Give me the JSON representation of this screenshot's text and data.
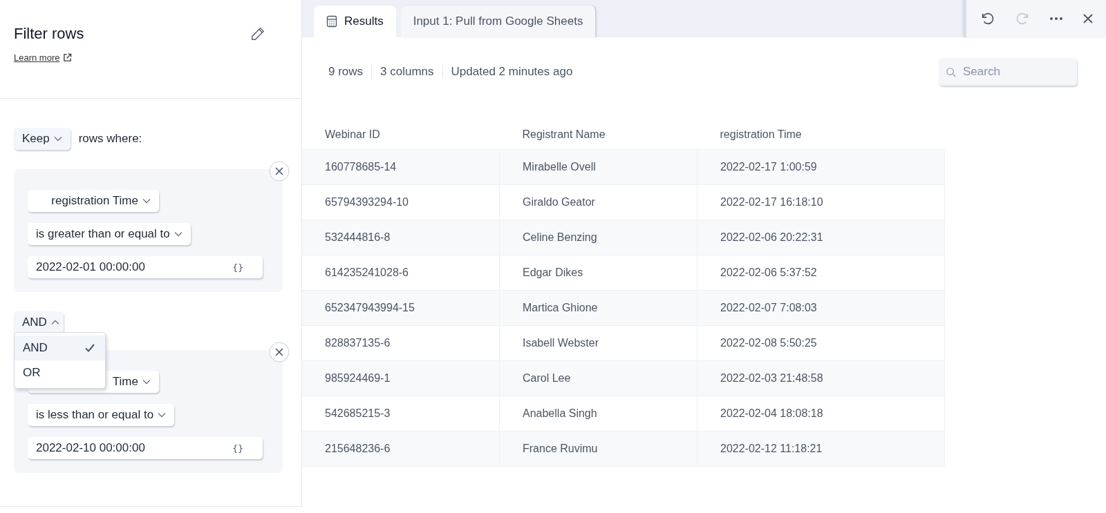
{
  "panel": {
    "title": "Filter rows",
    "learn_more": "Learn more",
    "mode": "Keep",
    "mode_suffix": "rows where:",
    "conditions": [
      {
        "column": "registration Time",
        "operator": "is greater than or equal to",
        "value": "2022-02-01 00:00:00",
        "value_icon": "{}"
      },
      {
        "column": "Time",
        "operator": "is less than or equal to",
        "value": "2022-02-10 00:00:00",
        "value_icon": "{}"
      }
    ],
    "joiner": {
      "value": "AND",
      "expanded": true,
      "options": [
        {
          "label": "AND",
          "selected": true
        },
        {
          "label": "OR",
          "selected": false
        }
      ]
    }
  },
  "tabs": [
    {
      "label": "Results",
      "selected": true,
      "kind": "calculator"
    },
    {
      "label": "Input 1: Pull from Google Sheets",
      "selected": false,
      "kind": "plain"
    }
  ],
  "stats": [
    "9 rows",
    "3 columns",
    "Updated 2 minutes ago"
  ],
  "search": {
    "placeholder": "Search"
  },
  "table": {
    "columns": [
      "Webinar ID",
      "Registrant Name",
      "registration Time"
    ],
    "rows": [
      [
        "160778685-14",
        "Mirabelle Ovell",
        "2022-02-17 1:00:59"
      ],
      [
        "65794393294-10",
        "Giraldo Geator",
        "2022-02-17 16:18:10"
      ],
      [
        "532444816-8",
        "Celine Benzing",
        "2022-02-06 20:22:31"
      ],
      [
        "614235241028-6",
        "Edgar Dikes",
        "2022-02-06 5:37:52"
      ],
      [
        "652347943994-15",
        "Martica Ghione",
        "2022-02-07 7:08:03"
      ],
      [
        "828837135-6",
        "Isabell Webster",
        "2022-02-08 5:50:25"
      ],
      [
        "985924469-1",
        "Carol Lee",
        "2022-02-03 21:48:58"
      ],
      [
        "542685215-3",
        "Anabella Singh",
        "2022-02-04 18:08:18"
      ],
      [
        "215648236-6",
        "France Ruvimu",
        "2022-02-12 11:18:21"
      ]
    ]
  }
}
